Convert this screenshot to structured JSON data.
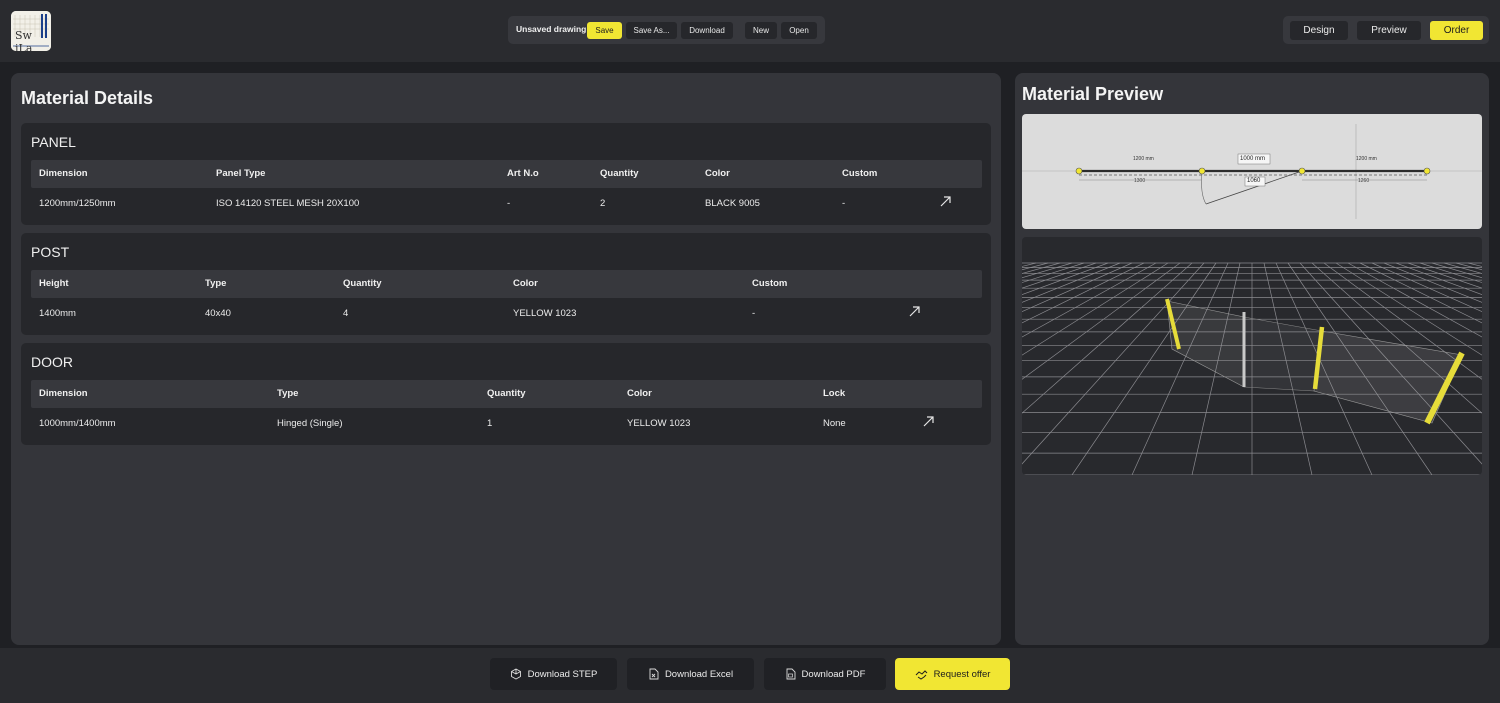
{
  "app": {
    "logo_text": "Sw iLa"
  },
  "toolbar": {
    "status": "Unsaved drawing",
    "save": "Save",
    "save_as": "Save As...",
    "download": "Download",
    "new": "New",
    "open": "Open"
  },
  "modes": {
    "design": "Design",
    "preview": "Preview",
    "order": "Order",
    "active": "order"
  },
  "material_details": {
    "title": "Material Details",
    "panel": {
      "title": "PANEL",
      "headers": [
        "Dimension",
        "Panel Type",
        "Art N.o",
        "Quantity",
        "Color",
        "Custom"
      ],
      "row": [
        "1200mm/1250mm",
        "ISO 14120 STEEL MESH 20X100",
        "-",
        "2",
        "BLACK 9005",
        "-"
      ]
    },
    "post": {
      "title": "POST",
      "headers": [
        "Height",
        "Type",
        "Quantity",
        "Color",
        "Custom"
      ],
      "row": [
        "1400mm",
        "40x40",
        "4",
        "YELLOW 1023",
        "-"
      ]
    },
    "door": {
      "title": "DOOR",
      "headers": [
        "Dimension",
        "Type",
        "Quantity",
        "Color",
        "Lock"
      ],
      "row": [
        "1000mm/1400mm",
        "Hinged (Single)",
        "1",
        "YELLOW 1023",
        "None"
      ]
    }
  },
  "material_preview": {
    "title": "Material Preview",
    "plan_labels": {
      "left_panel": "1200 mm",
      "door": "1000 mm",
      "right_panel": "1200 mm",
      "left_dim": "1300",
      "door_dim": "1060",
      "right_dim": "1260"
    }
  },
  "actions": {
    "download_step": "Download STEP",
    "download_excel": "Download Excel",
    "download_pdf": "Download PDF",
    "request_offer": "Request offer"
  },
  "colors": {
    "accent": "#f1e633",
    "background": "#1f2024",
    "panel": "#34353a"
  }
}
